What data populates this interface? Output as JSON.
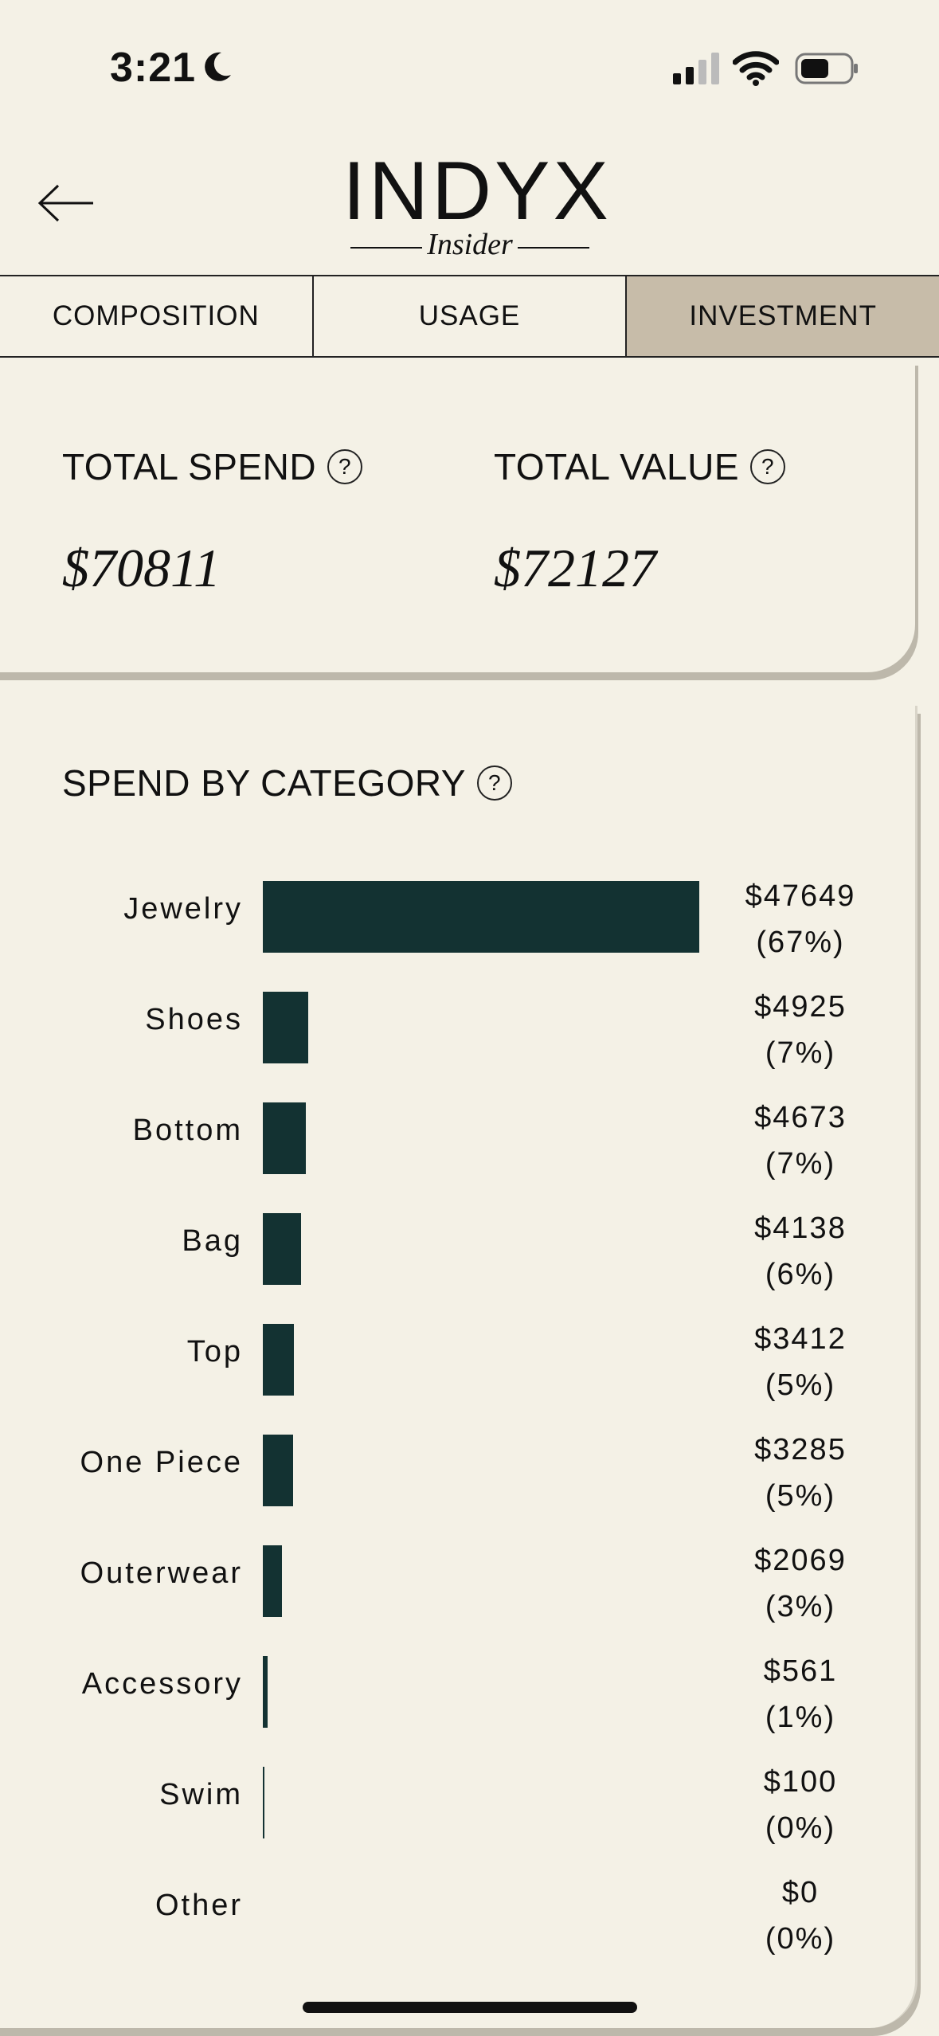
{
  "status_bar": {
    "time": "3:21",
    "icons": [
      "moon-icon",
      "signal-icon",
      "wifi-icon",
      "battery-icon"
    ]
  },
  "header": {
    "logo_main": "INDYX",
    "logo_sub": "Insider",
    "back_icon": "back-arrow-icon"
  },
  "tabs": [
    {
      "label": "COMPOSITION",
      "active": false
    },
    {
      "label": "USAGE",
      "active": false
    },
    {
      "label": "INVESTMENT",
      "active": true
    }
  ],
  "summary": {
    "total_spend_label": "TOTAL SPEND",
    "total_spend_value": "$70811",
    "total_value_label": "TOTAL VALUE",
    "total_value_value": "$72127",
    "help_glyph": "?"
  },
  "category_section": {
    "title": "SPEND BY CATEGORY",
    "help_glyph": "?"
  },
  "chart_data": {
    "type": "bar",
    "orientation": "horizontal",
    "title": "SPEND BY CATEGORY",
    "categories": [
      "Jewelry",
      "Shoes",
      "Bottom",
      "Bag",
      "Top",
      "One Piece",
      "Outerwear",
      "Accessory",
      "Swim",
      "Other"
    ],
    "values": [
      47649,
      4925,
      4673,
      4138,
      3412,
      3285,
      2069,
      561,
      100,
      0
    ],
    "value_labels": [
      "$47649",
      "$4925",
      "$4673",
      "$4138",
      "$3412",
      "$3285",
      "$2069",
      "$561",
      "$100",
      "$0"
    ],
    "percent_labels": [
      "(67%)",
      "(7%)",
      "(7%)",
      "(6%)",
      "(5%)",
      "(5%)",
      "(3%)",
      "(1%)",
      "(0%)",
      "(0%)"
    ],
    "bar_color": "#133232",
    "xlim": [
      0,
      47649
    ]
  },
  "colors": {
    "background": "#f4f1e6",
    "active_tab": "#c7bca9",
    "bar": "#133232"
  }
}
